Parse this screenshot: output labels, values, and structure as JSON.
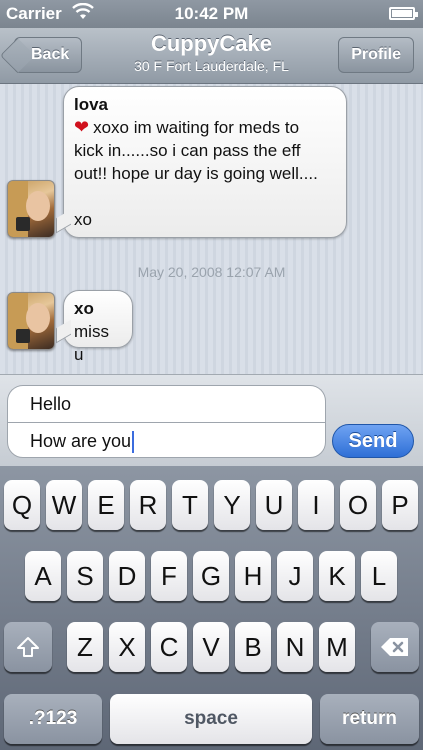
{
  "status_bar": {
    "carrier": "Carrier",
    "time": "10:42 PM"
  },
  "nav": {
    "back_label": "Back",
    "title": "CuppyCake",
    "subtitle": "30 F Fort Lauderdale, FL",
    "profile_label": "Profile"
  },
  "messages": [
    {
      "sender": "lova",
      "lines": [
        "xoxo im waiting for meds to",
        "kick in......so i can pass the eff",
        "out!! hope ur day is going well....",
        "",
        "xo"
      ]
    },
    {
      "sender": "xo",
      "lines": [
        "miss u"
      ]
    }
  ],
  "timestamp": "May 20, 2008 12:07 AM",
  "compose": {
    "subject_value": "Hello",
    "body_value": "How are you",
    "send_label": "Send"
  },
  "keyboard": {
    "row1": [
      "Q",
      "W",
      "E",
      "R",
      "T",
      "Y",
      "U",
      "I",
      "O",
      "P"
    ],
    "row2": [
      "A",
      "S",
      "D",
      "F",
      "G",
      "H",
      "J",
      "K",
      "L"
    ],
    "row3": [
      "Z",
      "X",
      "C",
      "V",
      "B",
      "N",
      "M"
    ],
    "numbers_label": ".?123",
    "space_label": "space",
    "return_label": "return"
  },
  "icons": {
    "wifi": "wifi-icon",
    "battery": "battery-icon",
    "heart": "heart-icon",
    "shift": "shift-icon",
    "delete": "delete-icon"
  },
  "colors": {
    "accent_blue": "#2e6fd6",
    "heart_red": "#d0111d"
  }
}
